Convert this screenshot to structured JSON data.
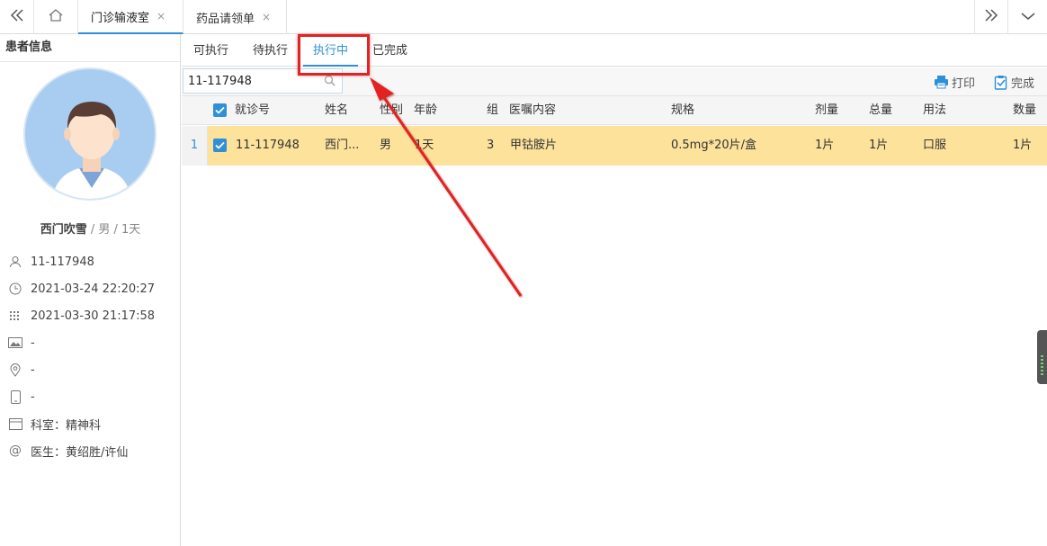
{
  "topbar": {
    "tabs": [
      {
        "label": "门诊输液室",
        "close": "×"
      },
      {
        "label": "药品请领单",
        "close": "×"
      }
    ]
  },
  "sidebar": {
    "title": "患者信息",
    "patient": {
      "name": "西门吹雪",
      "sep1": " / ",
      "gender": "男",
      "sep2": " / ",
      "age": "1天"
    },
    "rows": [
      {
        "icon": "person-icon",
        "text": "11-117948"
      },
      {
        "icon": "clock-icon",
        "text": "2021-03-24 22:20:27"
      },
      {
        "icon": "calendar-icon",
        "text": "2021-03-30 21:17:58"
      },
      {
        "icon": "image-icon",
        "text": "-"
      },
      {
        "icon": "location-icon",
        "text": "-"
      },
      {
        "icon": "phone-icon",
        "text": "-"
      },
      {
        "icon": "department-icon",
        "text": "科室：精神科"
      },
      {
        "icon": "at-icon",
        "text": "医生：黄绍胜/许仙"
      }
    ]
  },
  "subtabs": [
    "可执行",
    "待执行",
    "执行中",
    "已完成"
  ],
  "toolbar": {
    "search_value": "11-117948",
    "print_label": "打印",
    "complete_label": "完成"
  },
  "grid": {
    "headers": [
      "就诊号",
      "姓名",
      "性别",
      "年龄",
      "组",
      "医嘱内容",
      "规格",
      "剂量",
      "总量",
      "用法",
      "数量"
    ],
    "rows": [
      {
        "num": "1",
        "cells": [
          "11-117948",
          "西门...",
          "男",
          "1天",
          "3",
          "甲钴胺片",
          "0.5mg*20片/盒",
          "1片",
          "1片",
          "口服",
          "1片"
        ]
      }
    ]
  },
  "colors": {
    "accent": "#2f8fd8",
    "row_highlight": "#fde29b",
    "annotation": "#e32222"
  }
}
